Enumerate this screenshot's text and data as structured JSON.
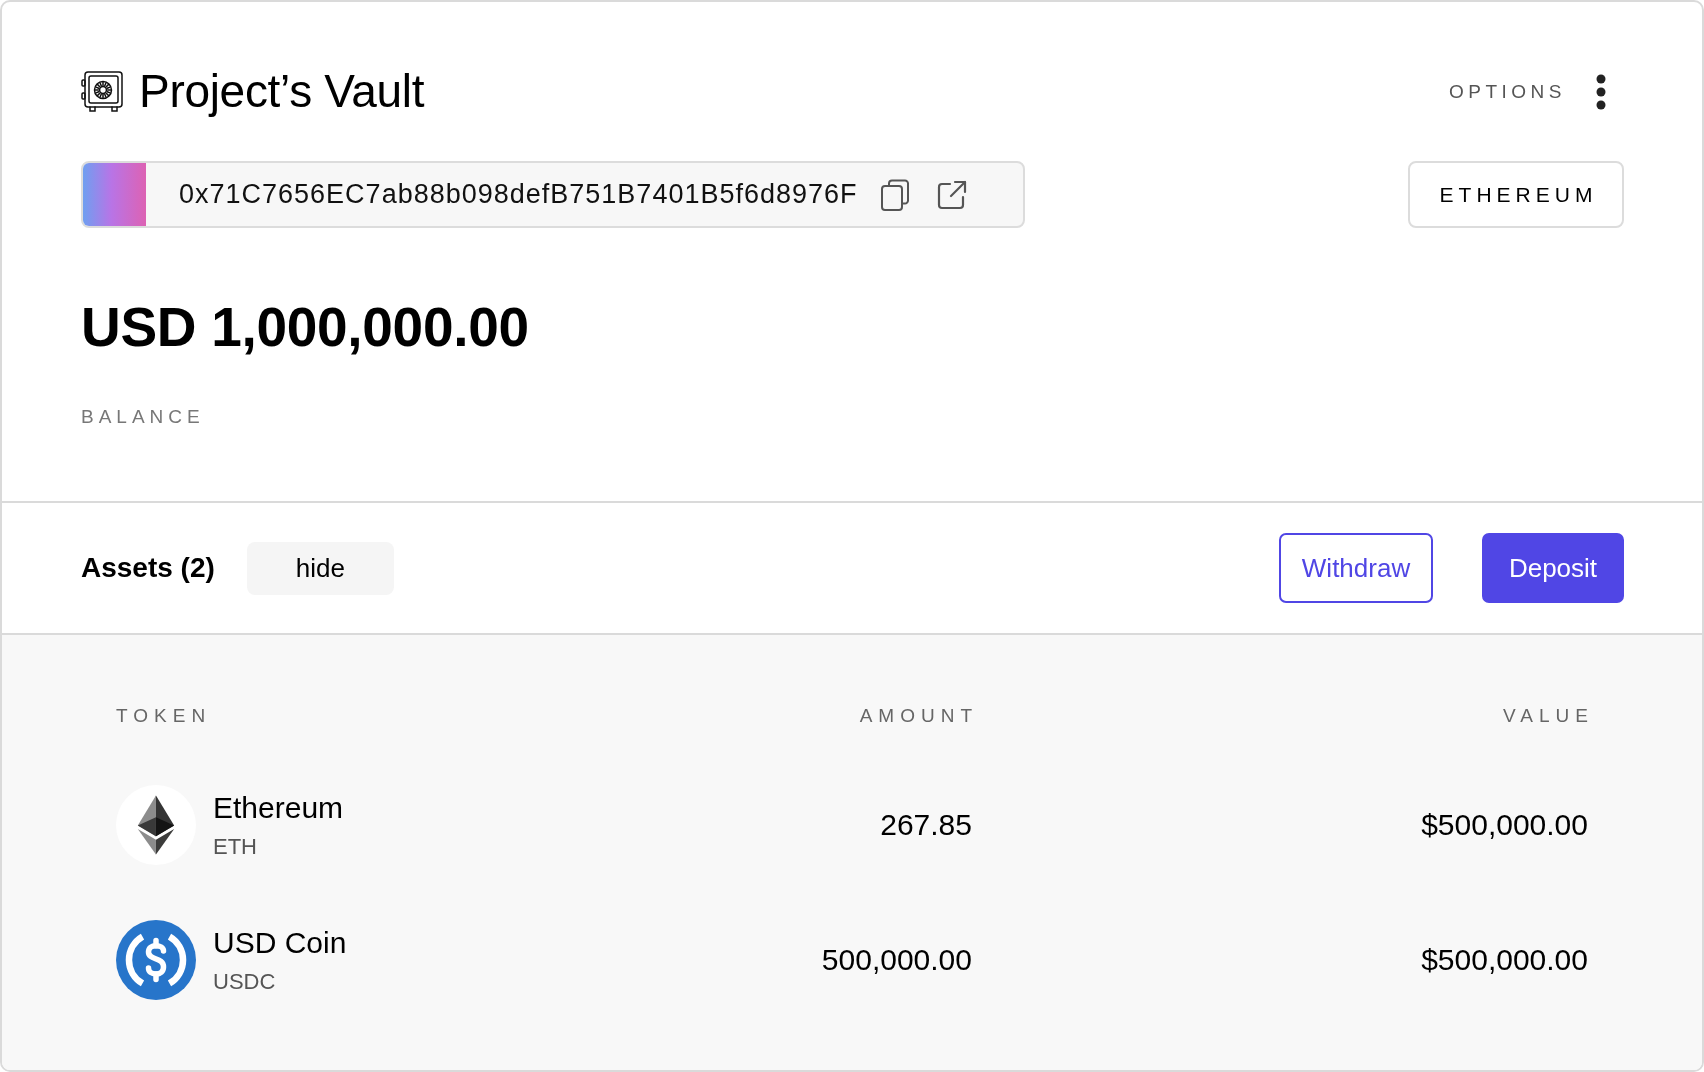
{
  "vault": {
    "title": "Project’s Vault",
    "options_label": "OPTIONS",
    "address": "0x71C7656EC7ab88b098defB751B7401B5f6d8976F",
    "network": "ETHEREUM",
    "balance": "USD 1,000,000.00",
    "balance_label": "BALANCE"
  },
  "assets": {
    "title": "Assets (2)",
    "toggle_label": "hide",
    "buttons": [
      {
        "label": "Withdraw",
        "kind": "outline"
      },
      {
        "label": "Deposit",
        "kind": "filled"
      }
    ]
  },
  "table": {
    "columns": [
      "TOKEN",
      "AMOUNT",
      "VALUE"
    ],
    "rows": [
      {
        "kind": "eth",
        "name": "Ethereum",
        "symbol": "ETH",
        "amount": "267.85",
        "value": "$500,000.00"
      },
      {
        "kind": "usdc",
        "name": "USD Coin",
        "symbol": "USDC",
        "amount": "500,000.00",
        "value": "$500,000.00"
      }
    ]
  }
}
